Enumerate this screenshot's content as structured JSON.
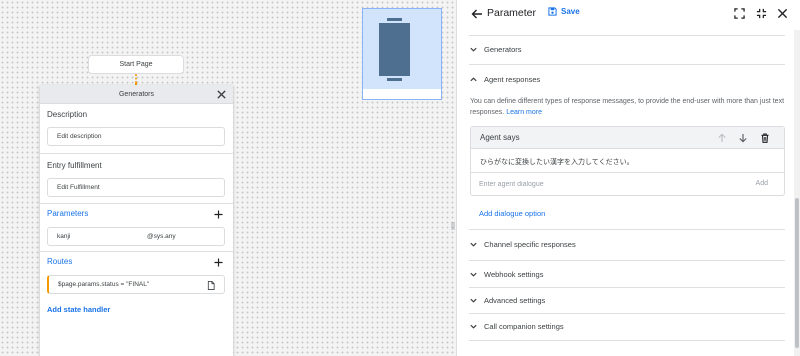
{
  "canvas": {
    "start_node_label": "Start Page",
    "page_card": {
      "title": "Generators",
      "description_label": "Description",
      "description_placeholder": "Edit description",
      "entry_fulfillment_label": "Entry fulfillment",
      "entry_fulfillment_placeholder": "Edit Fulfillment",
      "parameters_label": "Parameters",
      "parameter_row": {
        "name": "kanji",
        "type": "@sys.any"
      },
      "routes_label": "Routes",
      "route_row": "$page.params.status = \"FINAL\"",
      "add_state_handler_label": "Add state handler"
    }
  },
  "panel": {
    "title": "Parameter",
    "save_label": "Save",
    "sections": {
      "generators": "Generators",
      "agent_responses": "Agent responses",
      "channel_specific": "Channel specific responses",
      "webhook_settings": "Webhook settings",
      "advanced_settings": "Advanced settings",
      "call_companion": "Call companion settings"
    },
    "agent_responses": {
      "description": "You can define different types of response messages, to provide the end-user with more than just text responses.",
      "learn_more": "Learn more",
      "agent_says_title": "Agent says",
      "agent_says_text": "ひらがなに変換したい漢字を入力してください。",
      "input_placeholder": "Enter agent dialogue",
      "add_label": "Add",
      "add_dialogue_option": "Add dialogue option"
    }
  },
  "colors": {
    "accent": "#1a73e8",
    "connector": "#f29900",
    "thumbnail_bg": "#d2e3fc",
    "thumbnail_shape": "#4f6f91"
  },
  "icons": [
    "close-icon",
    "plus-icon",
    "file-icon",
    "arrow-back-icon",
    "save-icon",
    "fullscreen-icon",
    "fullscreen-exit-icon",
    "chevron-down-icon",
    "chevron-up-icon",
    "arrow-up-icon",
    "arrow-down-icon",
    "delete-icon",
    "drag-handle-icon"
  ]
}
